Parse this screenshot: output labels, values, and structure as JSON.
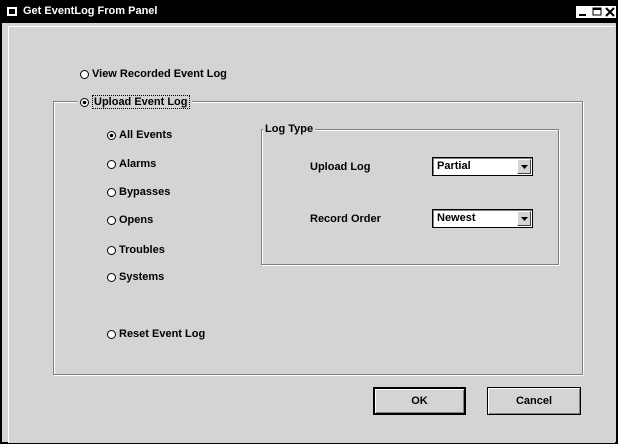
{
  "window": {
    "title": "Get EventLog From Panel",
    "icon": "app-icon",
    "controls": [
      "minimize-icon",
      "maximize-icon",
      "close-icon"
    ]
  },
  "options": {
    "view_recorded": {
      "label": "View Recorded Event Log",
      "selected": false
    },
    "upload": {
      "label": "Upload Event Log",
      "selected": true
    }
  },
  "event_types": [
    {
      "label": "All Events",
      "selected": true
    },
    {
      "label": "Alarms",
      "selected": false
    },
    {
      "label": "Bypasses",
      "selected": false
    },
    {
      "label": "Opens",
      "selected": false
    },
    {
      "label": "Troubles",
      "selected": false
    },
    {
      "label": "Systems",
      "selected": false
    }
  ],
  "reset": {
    "label": "Reset Event Log",
    "selected": false
  },
  "log_type": {
    "legend": "Log Type",
    "upload_log": {
      "label": "Upload Log",
      "value": "Partial"
    },
    "record_order": {
      "label": "Record Order",
      "value": "Newest"
    }
  },
  "buttons": {
    "ok": "OK",
    "cancel": "Cancel"
  }
}
